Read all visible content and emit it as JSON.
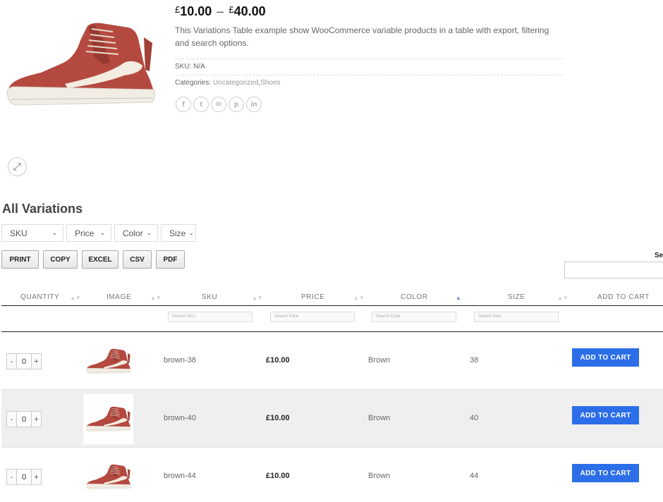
{
  "product": {
    "price_currency": "£",
    "price_min": "10.00",
    "price_dash": "–",
    "price_max": "40.00",
    "description": "This Variations Table example show WooCommerce variable products in a table with export, filtering and search options.",
    "sku_label": "SKU:",
    "sku_value": "N/A",
    "categories_label": "Categories:",
    "categories": [
      "Uncategorized",
      "Shoes"
    ],
    "category_separator": ",",
    "share_icons": [
      "facebook-icon",
      "twitter-icon",
      "email-icon",
      "pinterest-icon",
      "linkedin-icon"
    ],
    "share_glyphs": [
      "f",
      "t",
      "✉",
      "p",
      "in"
    ]
  },
  "variations": {
    "title": "All Variations",
    "filters": [
      "SKU",
      "Price",
      "Color",
      "Size"
    ],
    "export_buttons": [
      "PRINT",
      "COPY",
      "EXCEL",
      "CSV",
      "PDF"
    ],
    "search_label": "Se"
  },
  "table": {
    "columns": [
      "QUANTITY",
      "IMAGE",
      "SKU",
      "PRICE",
      "COLOR",
      "SIZE",
      "ADD TO CART"
    ],
    "sorted_column": "COLOR",
    "column_search_placeholders": {
      "sku": "Search SKU",
      "price": "Search Price",
      "color": "Search Color",
      "size": "Search Size"
    },
    "rows": [
      {
        "qty": "0",
        "sku": "brown-38",
        "price": "£10.00",
        "color": "Brown",
        "size": "38",
        "cart": "ADD TO CART"
      },
      {
        "qty": "0",
        "sku": "brown-40",
        "price": "£10.00",
        "color": "Brown",
        "size": "40",
        "cart": "ADD TO CART"
      },
      {
        "qty": "0",
        "sku": "brown-44",
        "price": "£10.00",
        "color": "Brown",
        "size": "44",
        "cart": "ADD TO CART"
      }
    ],
    "qty_minus": "-",
    "qty_plus": "+"
  },
  "colors": {
    "accent_button": "#2b6ee8",
    "shoe_red": "#b4493f",
    "row_alt": "#efefef"
  }
}
